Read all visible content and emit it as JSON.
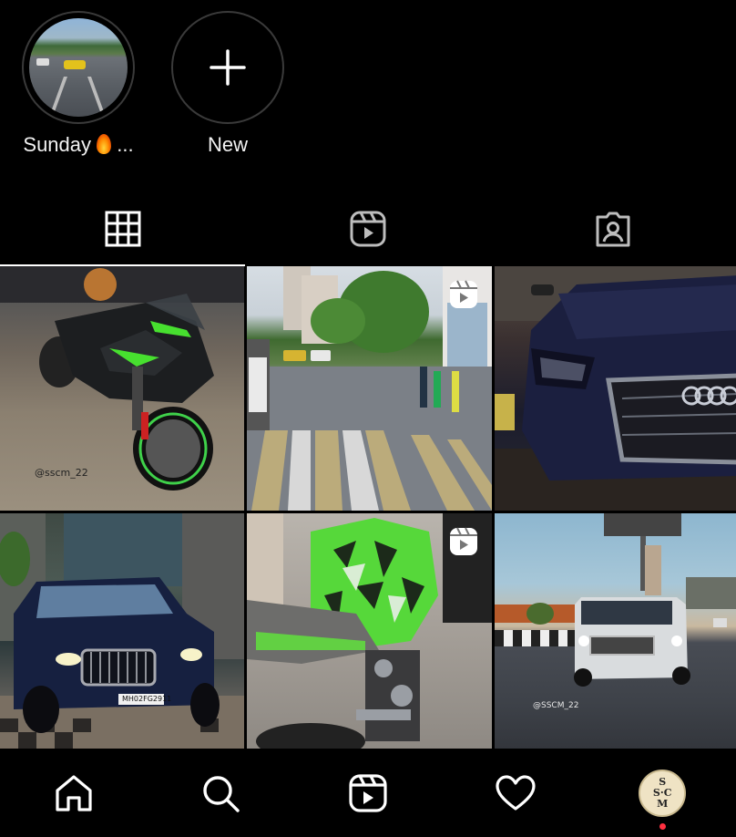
{
  "highlights": [
    {
      "label": "Sunday",
      "emoji": "🔥",
      "suffix": "..."
    },
    {
      "label": "New"
    }
  ],
  "tabs": [
    {
      "name": "grid",
      "icon": "grid-icon",
      "active": true
    },
    {
      "name": "reels",
      "icon": "reels-icon",
      "active": false
    },
    {
      "name": "tagged",
      "icon": "tagged-icon",
      "active": false
    }
  ],
  "posts": [
    {
      "subject": "green motorcycle",
      "watermark": "@sscm_22",
      "is_reel": false
    },
    {
      "subject": "city street crosswalk",
      "watermark": "",
      "is_reel": true
    },
    {
      "subject": "blue audi",
      "watermark": "",
      "is_reel": false
    },
    {
      "subject": "blue mercedes maybach",
      "watermark": "",
      "is_reel": false,
      "plate": "MH02FG2911"
    },
    {
      "subject": "green motorcycle z900",
      "watermark": "",
      "is_reel": true
    },
    {
      "subject": "white g-wagon",
      "watermark": "@SSCM_22",
      "is_reel": false
    }
  ],
  "bottom_nav": [
    {
      "name": "home",
      "icon": "home-icon"
    },
    {
      "name": "search",
      "icon": "search-icon"
    },
    {
      "name": "reels",
      "icon": "reels-icon"
    },
    {
      "name": "activity",
      "icon": "heart-icon"
    },
    {
      "name": "profile",
      "icon": "avatar",
      "avatar_letters": [
        "S",
        "S",
        "C",
        "M"
      ],
      "has_notification": true
    }
  ],
  "colors": {
    "background": "#000000",
    "notification": "#ff3040"
  }
}
